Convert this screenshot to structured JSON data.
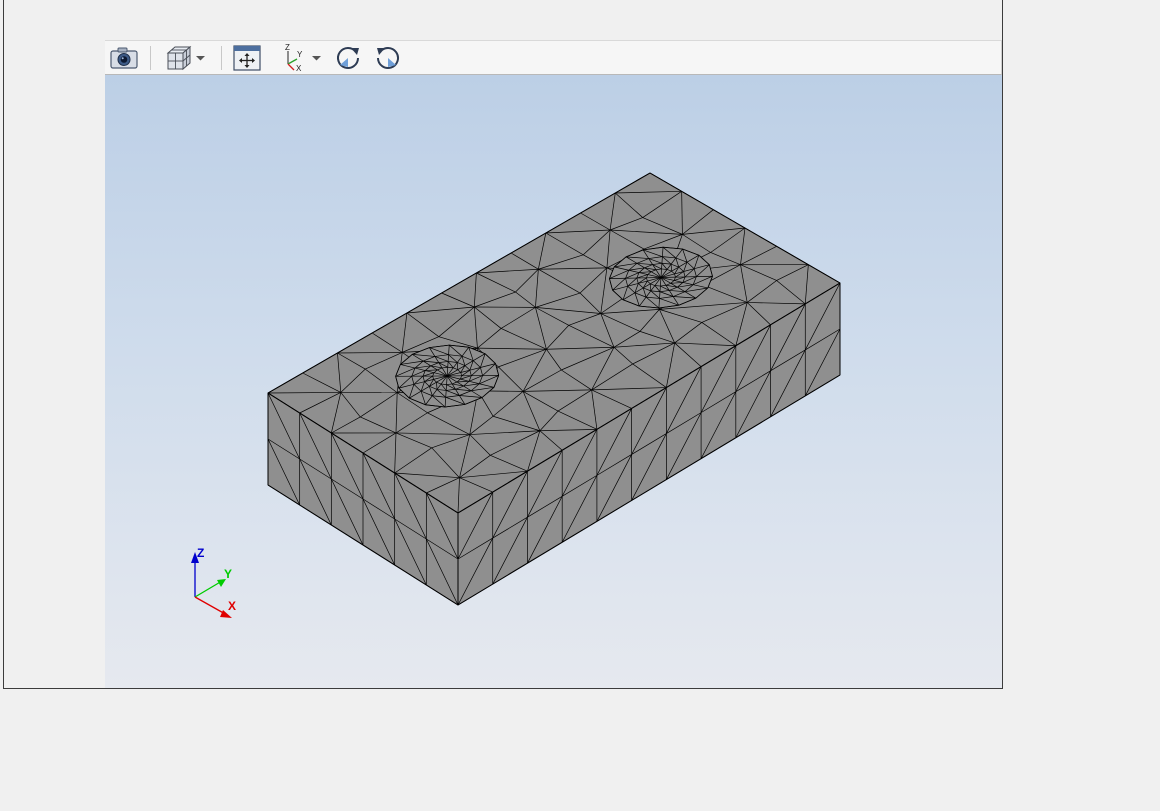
{
  "toolbar": {
    "buttons": [
      {
        "name": "export-button",
        "icon": "camera-icon",
        "tooltip": ""
      },
      {
        "name": "view-style-button",
        "icon": "cube-wireframe-icon",
        "has_menu": true
      },
      {
        "name": "restore-view-button",
        "icon": "restore-view-icon"
      },
      {
        "name": "axes-view-button",
        "icon": "xyz-axes-icon",
        "has_menu": true
      },
      {
        "name": "rotate-cw-button",
        "icon": "rotate-clockwise-icon"
      },
      {
        "name": "rotate-ccw-button",
        "icon": "rotate-counterclockwise-icon"
      }
    ]
  },
  "viewport": {
    "background_top": "#bccfe6",
    "background_bottom": "#e6e9ef",
    "mesh_face_color": "#8f8f8f",
    "mesh_edge_color": "#000000"
  },
  "triad": {
    "z_label": "Z",
    "y_label": "Y",
    "x_label": "X",
    "z_color": "#0000cc",
    "y_color": "#00cc00",
    "x_color": "#e00000"
  }
}
